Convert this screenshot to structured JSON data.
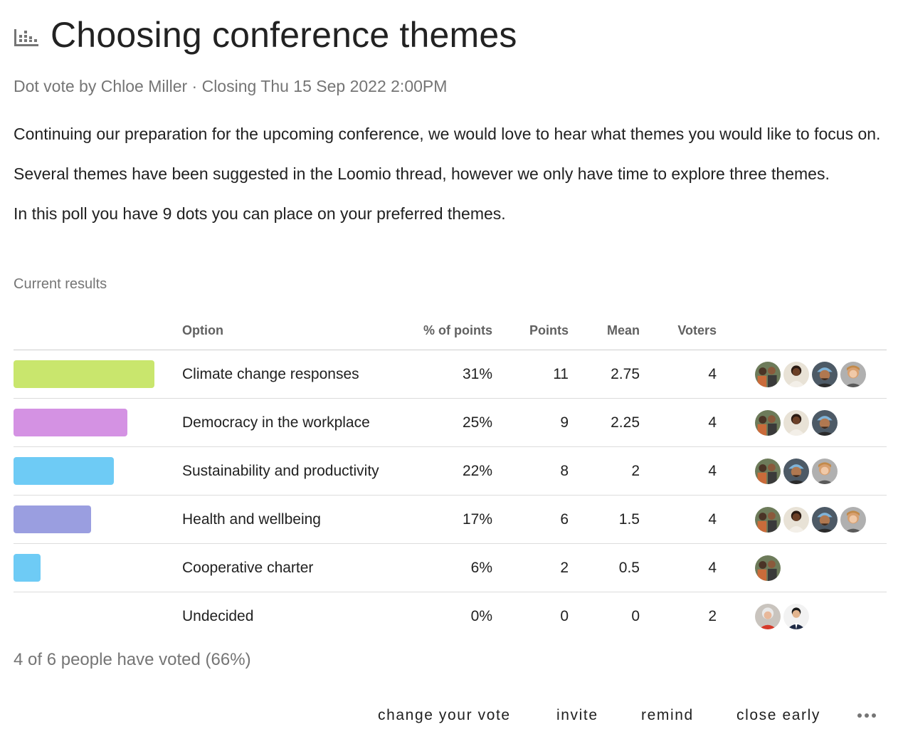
{
  "poll": {
    "title": "Choosing conference themes",
    "icon": "bar-chart-icon",
    "meta": "Dot vote by Chloe Miller · Closing Thu 15 Sep 2022 2:00PM",
    "description": [
      "Continuing our preparation for the upcoming conference, we would love to hear what themes you would like to focus on.",
      "Several themes have been suggested in the Loomio thread, however we only have time to explore three themes.",
      "In this poll you have 9 dots you can place on your preferred themes."
    ]
  },
  "results": {
    "label": "Current results",
    "headers": {
      "option": "Option",
      "percent": "% of points",
      "points": "Points",
      "mean": "Mean",
      "voters": "Voters"
    },
    "rows": [
      {
        "option": "Climate change responses",
        "percent": "31%",
        "points": "11",
        "mean": "2.75",
        "voters": "4",
        "color": "#c9e66d",
        "share": 0.31,
        "avatars": [
          "a",
          "b",
          "c",
          "d"
        ]
      },
      {
        "option": "Democracy in the workplace",
        "percent": "25%",
        "points": "9",
        "mean": "2.25",
        "voters": "4",
        "color": "#d492e3",
        "share": 0.25,
        "avatars": [
          "a",
          "b",
          "c"
        ]
      },
      {
        "option": "Sustainability and productivity",
        "percent": "22%",
        "points": "8",
        "mean": "2",
        "voters": "4",
        "color": "#6ecbf5",
        "share": 0.22,
        "avatars": [
          "a",
          "c",
          "d"
        ]
      },
      {
        "option": "Health and wellbeing",
        "percent": "17%",
        "points": "6",
        "mean": "1.5",
        "voters": "4",
        "color": "#9a9ee0",
        "share": 0.17,
        "avatars": [
          "a",
          "b",
          "c",
          "d"
        ]
      },
      {
        "option": "Cooperative charter",
        "percent": "6%",
        "points": "2",
        "mean": "0.5",
        "voters": "4",
        "color": "#6ecbf5",
        "share": 0.06,
        "avatars": [
          "a"
        ]
      },
      {
        "option": "Undecided",
        "percent": "0%",
        "points": "0",
        "mean": "0",
        "voters": "2",
        "color": "",
        "share": 0,
        "avatars": [
          "e",
          "f"
        ]
      }
    ]
  },
  "summary": "4 of 6 people have voted (66%)",
  "actions": {
    "change_vote": "change your vote",
    "invite": "invite",
    "remind": "remind",
    "close_early": "close early",
    "more_icon": "more-horizontal-icon"
  }
}
